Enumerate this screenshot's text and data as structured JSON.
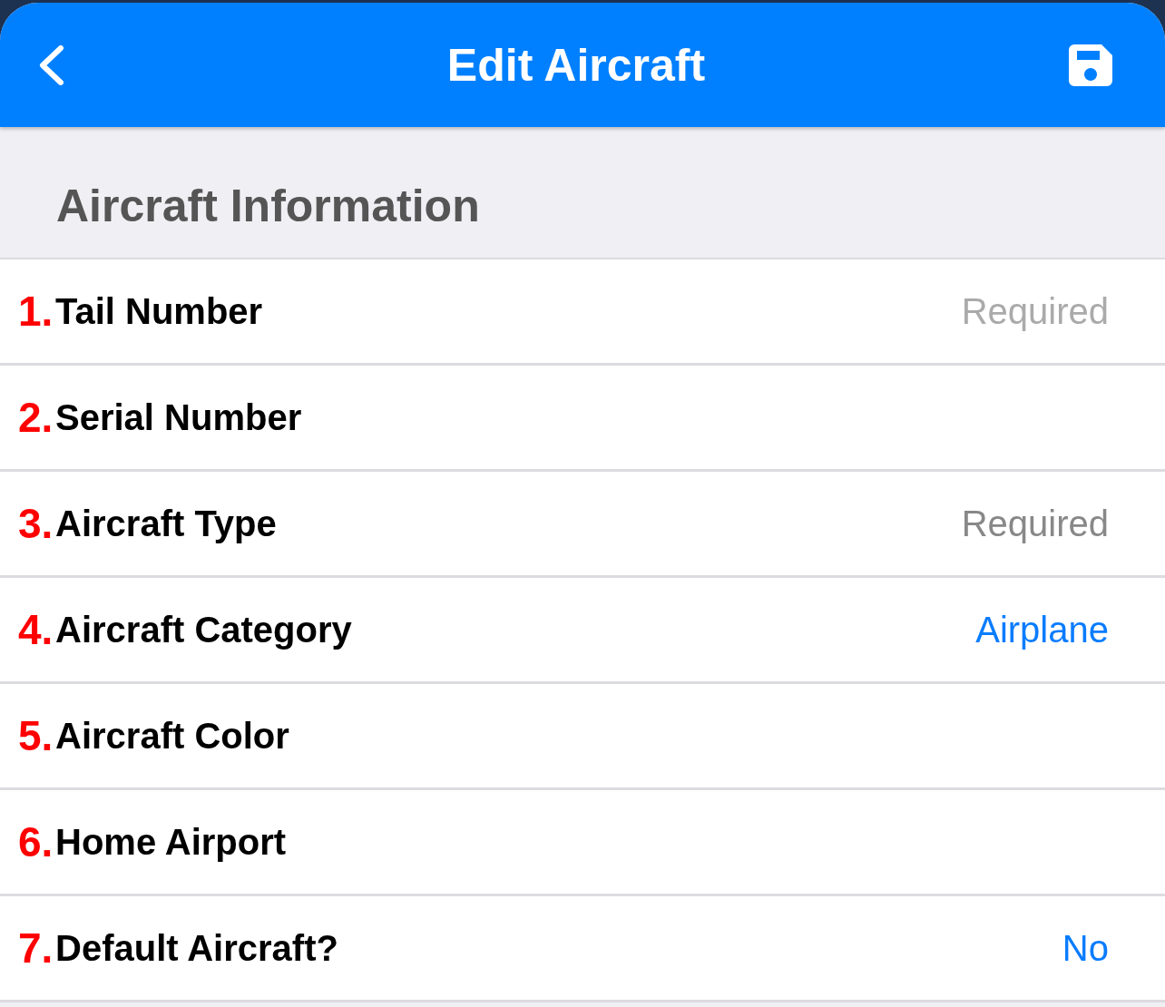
{
  "header": {
    "title": "Edit Aircraft"
  },
  "section": {
    "title": "Aircraft Information"
  },
  "rows": [
    {
      "number": "1.",
      "label": "Tail Number",
      "value": "Required",
      "kind": "placeholder"
    },
    {
      "number": "2.",
      "label": "Serial Number"
    },
    {
      "number": "3.",
      "label": "Aircraft Type",
      "value": "Required",
      "kind": "picker"
    },
    {
      "number": "4.",
      "label": "Aircraft Category",
      "value": "Airplane",
      "kind": "link"
    },
    {
      "number": "5.",
      "label": "Aircraft Color"
    },
    {
      "number": "6.",
      "label": "Home Airport"
    },
    {
      "number": "7.",
      "label": "Default Aircraft?",
      "value": "No",
      "kind": "link"
    }
  ]
}
